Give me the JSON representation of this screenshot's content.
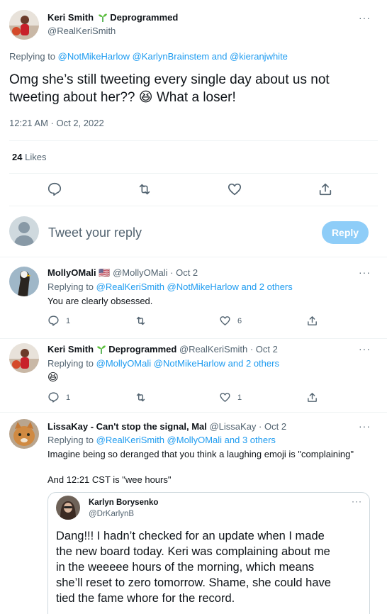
{
  "main_tweet": {
    "author_name": "Keri Smith",
    "author_badge": "Deprogrammed",
    "handle": "@RealKeriSmith",
    "replying_prefix": "Replying to ",
    "replying_to": "@NotMikeHarlow @KarlynBrainstem and @kieranjwhite",
    "text_line1": "Omg she’s still tweeting every single day about us not",
    "text_line2_a": "tweeting about her??",
    "text_emoji": "😆",
    "text_line2_b": "What a loser!",
    "timestamp": "12:21 AM · Oct 2, 2022",
    "likes_count": "24",
    "likes_label": "Likes"
  },
  "compose": {
    "placeholder": "Tweet your reply",
    "button_label": "Reply"
  },
  "replies": [
    {
      "author_name": "MollyOMali",
      "flag": "🇺🇸",
      "handle_date": "@MollyOMali · Oct 2",
      "replying_prefix": "Replying to ",
      "replying_to": "@RealKeriSmith @NotMikeHarlow and 2 others",
      "text": "You are clearly obsessed.",
      "reply_count": "1",
      "retweet_count": "",
      "like_count": "6"
    },
    {
      "author_name": "Keri Smith",
      "author_badge": "Deprogrammed",
      "handle_date": "@RealKeriSmith · Oct 2",
      "replying_prefix": "Replying to ",
      "replying_to": "@MollyOMali @NotMikeHarlow and 2 others",
      "text": "😆",
      "reply_count": "1",
      "retweet_count": "",
      "like_count": "1"
    },
    {
      "author_name": "LissaKay - Can't stop the signal, Mal",
      "handle_date": "@LissaKay · Oct 2",
      "replying_prefix": "Replying to ",
      "replying_to": "@RealKeriSmith @MollyOMali and 3 others",
      "text_line1": "Imagine being so deranged that you think a laughing emoji is \"complaining\"",
      "text_line2": "And 12:21 CST is \"wee hours\""
    }
  ],
  "quoted_tweet": {
    "author_name": "Karlyn Borysenko",
    "handle": "@DrKarlynB",
    "lines": [
      "Dang!!! I hadn’t checked for an update when I made",
      "the new board today. Keri was complaining about me",
      "in the weeeee hours of the morning, which means",
      "she’ll reset to zero tomorrow. Shame, she could have",
      "tied the fame whore for the record."
    ]
  },
  "icons": {
    "more": "more-icon",
    "reply": "reply-icon",
    "retweet": "retweet-icon",
    "like": "like-icon",
    "share": "share-icon",
    "badge": "sprout-icon"
  },
  "colors": {
    "link": "#1d9bf0",
    "secondary": "#536471",
    "reply_button": "#8ecdf8",
    "divider": "#eff3f4"
  }
}
